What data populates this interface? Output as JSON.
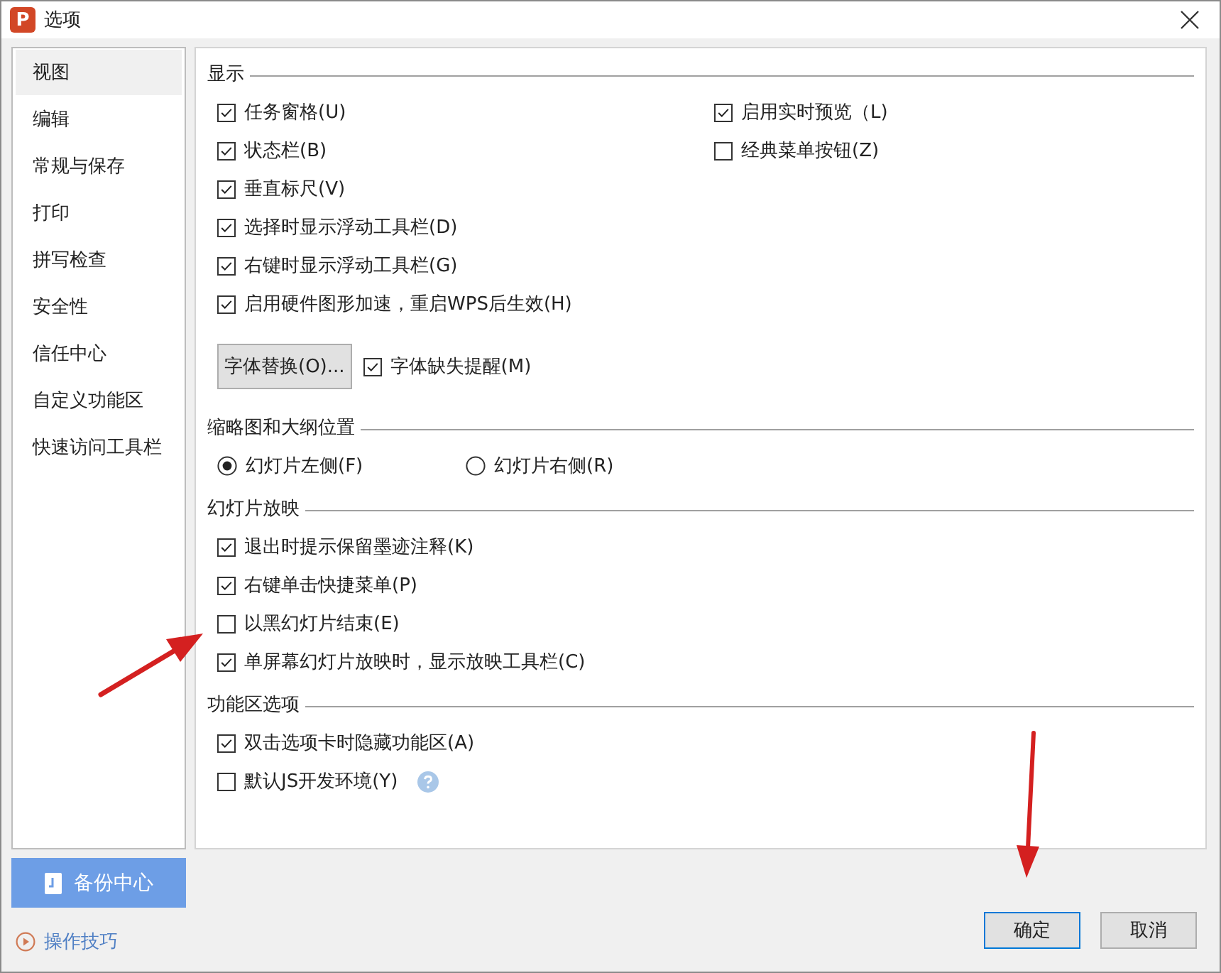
{
  "window": {
    "title": "选项",
    "app_icon": "P"
  },
  "sidebar": {
    "items": [
      {
        "label": "视图",
        "selected": true
      },
      {
        "label": "编辑",
        "selected": false
      },
      {
        "label": "常规与保存",
        "selected": false
      },
      {
        "label": "打印",
        "selected": false
      },
      {
        "label": "拼写检查",
        "selected": false
      },
      {
        "label": "安全性",
        "selected": false
      },
      {
        "label": "信任中心",
        "selected": false
      },
      {
        "label": "自定义功能区",
        "selected": false
      },
      {
        "label": "快速访问工具栏",
        "selected": false
      }
    ],
    "backup_button": "备份中心",
    "tips_link": "操作技巧"
  },
  "sections": [
    {
      "title": "显示",
      "kind": "options",
      "rows": [
        [
          {
            "kind": "checkbox",
            "label": "任务窗格(U)",
            "checked": true
          },
          {
            "kind": "checkbox",
            "label": "启用实时预览（L)",
            "checked": true
          }
        ],
        [
          {
            "kind": "checkbox",
            "label": "状态栏(B)",
            "checked": true
          },
          {
            "kind": "checkbox",
            "label": "经典菜单按钮(Z)",
            "checked": false
          }
        ],
        [
          {
            "kind": "checkbox",
            "label": "垂直标尺(V)",
            "checked": true
          }
        ],
        [
          {
            "kind": "checkbox",
            "label": "选择时显示浮动工具栏(D)",
            "checked": true
          }
        ],
        [
          {
            "kind": "checkbox",
            "label": "右键时显示浮动工具栏(G)",
            "checked": true
          }
        ],
        [
          {
            "kind": "checkbox",
            "label": "启用硬件图形加速，重启WPS后生效(H)",
            "checked": true
          }
        ],
        [
          {
            "kind": "button",
            "label": "字体替换(O)..."
          },
          {
            "kind": "checkbox",
            "label": "字体缺失提醒(M)",
            "checked": true
          }
        ]
      ]
    },
    {
      "title": "缩略图和大纲位置",
      "kind": "choice",
      "rows": [
        [
          {
            "kind": "radio",
            "label": "幻灯片左侧(F)",
            "selected": true
          },
          {
            "kind": "radio",
            "label": "幻灯片右侧(R)",
            "selected": false
          }
        ]
      ]
    },
    {
      "title": "幻灯片放映",
      "kind": "options",
      "rows": [
        [
          {
            "kind": "checkbox",
            "label": "退出时提示保留墨迹注释(K)",
            "checked": true
          }
        ],
        [
          {
            "kind": "checkbox",
            "label": "右键单击快捷菜单(P)",
            "checked": true
          }
        ],
        [
          {
            "kind": "checkbox",
            "label": "以黑幻灯片结束(E)",
            "checked": false
          }
        ],
        [
          {
            "kind": "checkbox",
            "label": "单屏幕幻灯片放映时，显示放映工具栏(C)",
            "checked": true
          }
        ]
      ]
    },
    {
      "title": "功能区选项",
      "kind": "options",
      "rows": [
        [
          {
            "kind": "checkbox",
            "label": "双击选项卡时隐藏功能区(A)",
            "checked": true
          }
        ],
        [
          {
            "kind": "checkbox",
            "label": "默认JS开发环境(Y)",
            "checked": false,
            "help": true
          }
        ]
      ]
    }
  ],
  "buttons": [
    "确定",
    "取消"
  ]
}
